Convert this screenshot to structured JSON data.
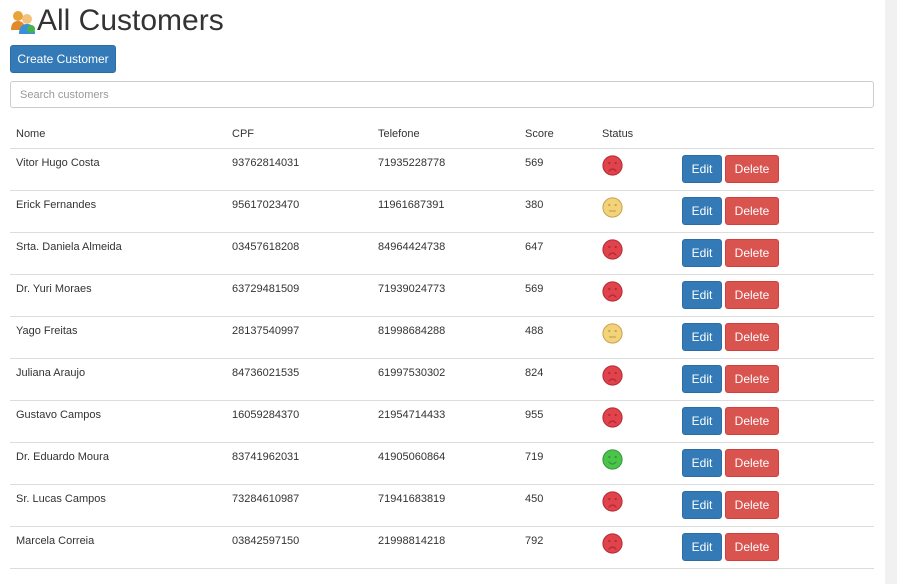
{
  "page": {
    "title": "All Customers",
    "header_icon": "customers-group-icon",
    "create_button": "Create Customer",
    "search_placeholder": "Search customers",
    "search_value": ""
  },
  "table": {
    "columns": [
      "Nome",
      "CPF",
      "Telefone",
      "Score",
      "Status"
    ],
    "edit_label": "Edit",
    "delete_label": "Delete",
    "rows": [
      {
        "nome": "Vitor Hugo Costa",
        "cpf": "93762814031",
        "telefone": "71935228778",
        "score": "569",
        "status": "sad"
      },
      {
        "nome": "Erick Fernandes",
        "cpf": "95617023470",
        "telefone": "11961687391",
        "score": "380",
        "status": "neutral"
      },
      {
        "nome": "Srta. Daniela Almeida",
        "cpf": "03457618208",
        "telefone": "84964424738",
        "score": "647",
        "status": "sad"
      },
      {
        "nome": "Dr. Yuri Moraes",
        "cpf": "63729481509",
        "telefone": "71939024773",
        "score": "569",
        "status": "sad"
      },
      {
        "nome": "Yago Freitas",
        "cpf": "28137540997",
        "telefone": "81998684288",
        "score": "488",
        "status": "neutral"
      },
      {
        "nome": "Juliana Araujo",
        "cpf": "84736021535",
        "telefone": "61997530302",
        "score": "824",
        "status": "sad"
      },
      {
        "nome": "Gustavo Campos",
        "cpf": "16059284370",
        "telefone": "21954714433",
        "score": "955",
        "status": "sad"
      },
      {
        "nome": "Dr. Eduardo Moura",
        "cpf": "83741962031",
        "telefone": "41905060864",
        "score": "719",
        "status": "happy"
      },
      {
        "nome": "Sr. Lucas Campos",
        "cpf": "73284610987",
        "telefone": "71941683819",
        "score": "450",
        "status": "sad"
      },
      {
        "nome": "Marcela Correia",
        "cpf": "03842597150",
        "telefone": "21998814218",
        "score": "792",
        "status": "sad"
      }
    ]
  },
  "status_colors": {
    "sad": "#e0434c",
    "neutral": "#f3d37a",
    "happy": "#4cc44c"
  },
  "colors": {
    "primary": "#337ab7",
    "danger": "#d9534f"
  }
}
